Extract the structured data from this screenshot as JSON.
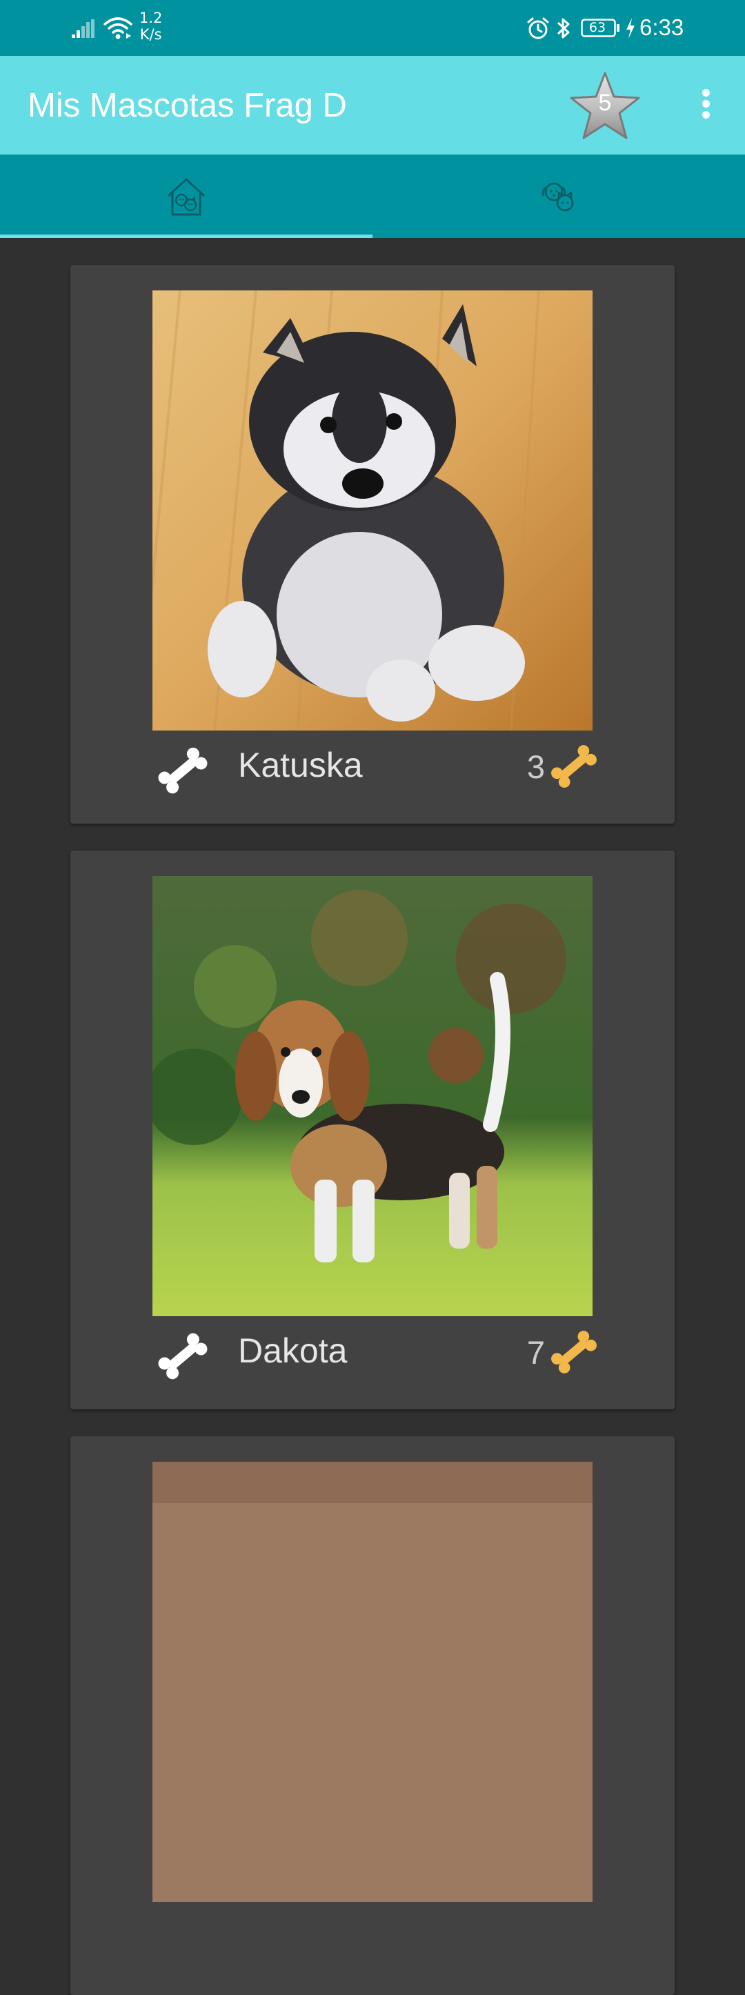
{
  "status_bar": {
    "network_speed_value": "1.2",
    "network_speed_unit": "K/s",
    "battery_level": "63",
    "time": "6:33",
    "icons": [
      "signal-icon",
      "wifi-icon",
      "alarm-icon",
      "bluetooth-icon",
      "battery-icon",
      "charging-icon"
    ]
  },
  "app_bar": {
    "title": "Mis Mascotas Frag D",
    "favorites_count": "5",
    "icons": [
      "star-icon",
      "more-vert-icon"
    ]
  },
  "tabs": [
    {
      "icon": "pet-house-icon",
      "selected": true
    },
    {
      "icon": "dog-cat-icon",
      "selected": false
    }
  ],
  "pets": [
    {
      "name": "Katuska",
      "rating": "3",
      "photo": "husky-puppy-photo"
    },
    {
      "name": "Dakota",
      "rating": "7",
      "photo": "beagle-puppy-photo"
    },
    {
      "name": "",
      "rating": "",
      "photo": "partial-pet-photo"
    }
  ],
  "colors": {
    "status_bar": "#00939f",
    "app_bar": "#65dde4",
    "tab_bar": "#00939f",
    "tab_indicator": "#6be2e8",
    "background": "#303030",
    "card": "#424242",
    "bone_like": "#ffffff",
    "bone_rating": "#f2b84b"
  }
}
